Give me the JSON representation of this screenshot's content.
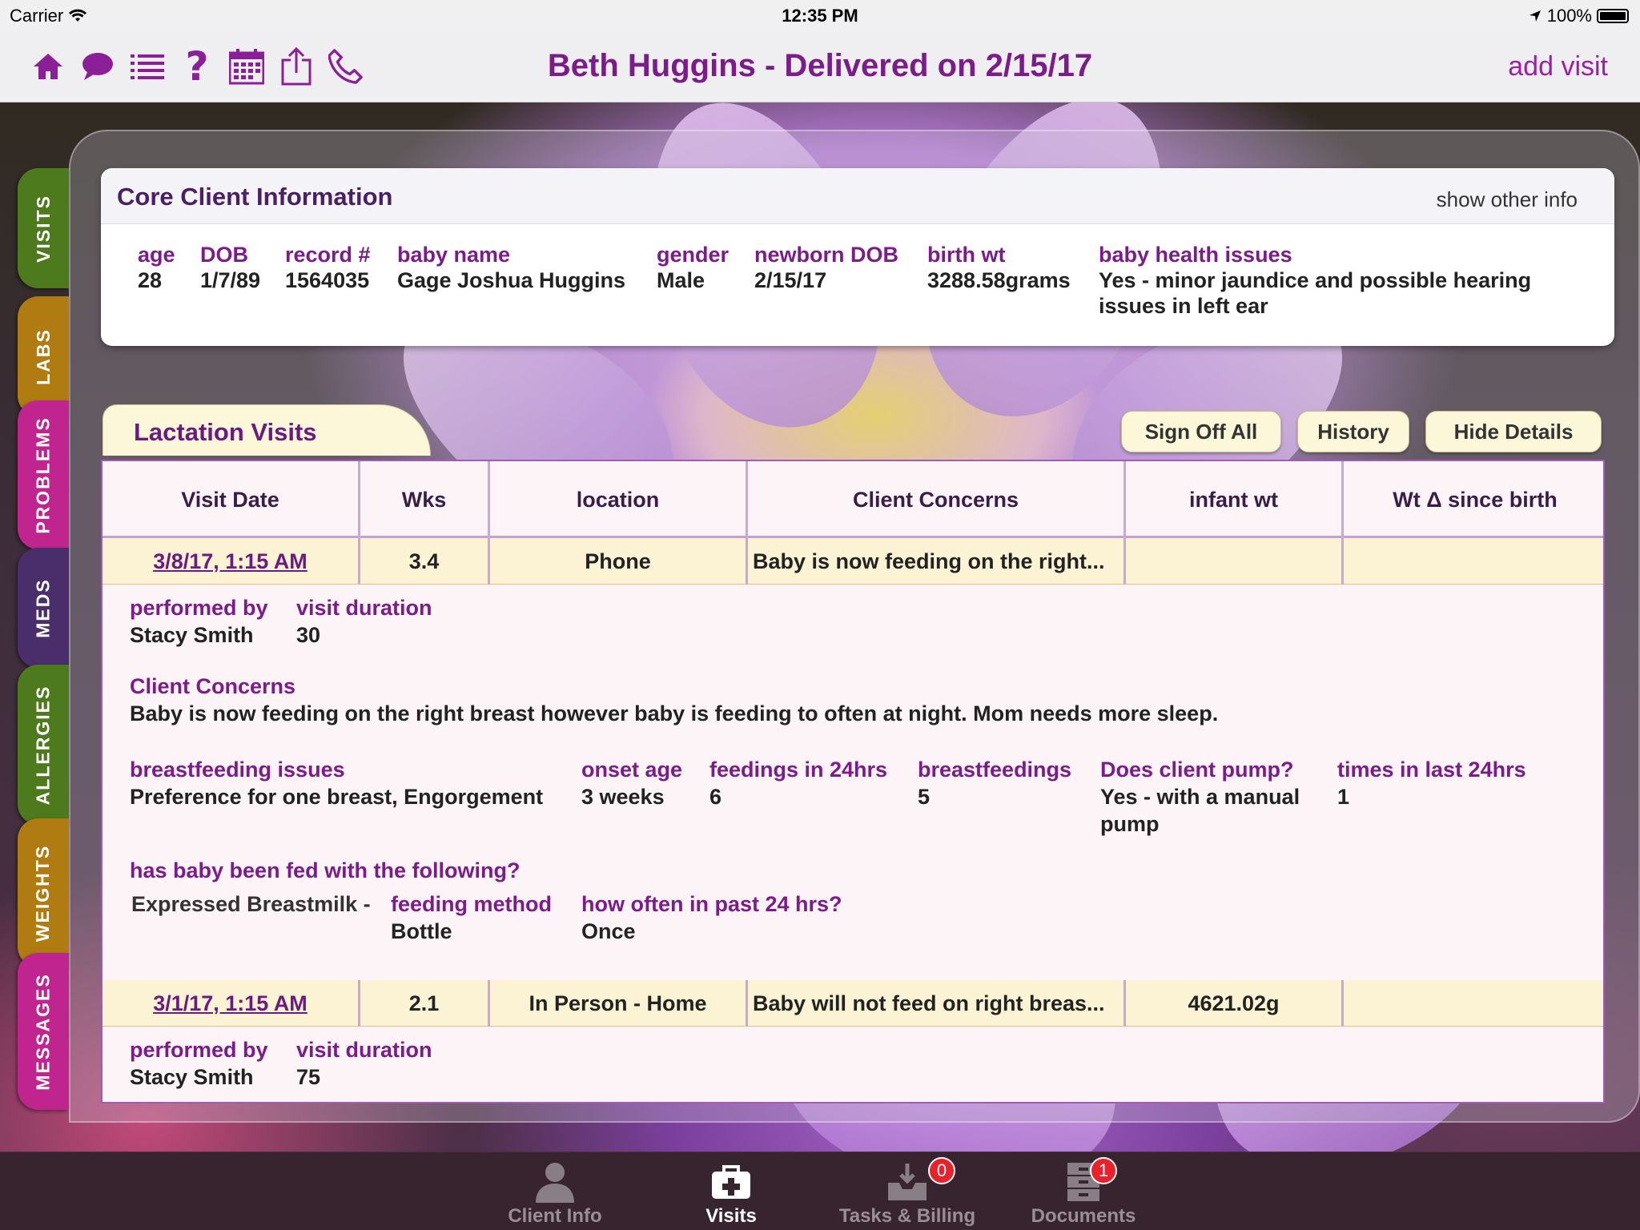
{
  "status_bar": {
    "carrier": "Carrier",
    "time": "12:35 PM",
    "battery": "100%"
  },
  "nav": {
    "title": "Beth Huggins - Delivered on 2/15/17",
    "add_visit": "add visit",
    "icons": [
      "home-icon",
      "chat-icon",
      "list-icon",
      "help-icon",
      "calendar-icon",
      "share-icon",
      "phone-icon"
    ]
  },
  "side_tabs": [
    {
      "label": "VISITS",
      "color": "#4e7a1e"
    },
    {
      "label": "LABS",
      "color": "#b07c12"
    },
    {
      "label": "PROBLEMS",
      "color": "#c0258f"
    },
    {
      "label": "MEDS",
      "color": "#4a2d6b"
    },
    {
      "label": "ALLERGIES",
      "color": "#4e7a1e"
    },
    {
      "label": "WEIGHTS",
      "color": "#b07c12"
    },
    {
      "label": "MESSAGES",
      "color": "#c0258f"
    }
  ],
  "core": {
    "title": "Core Client Information",
    "show_other": "show other info",
    "fields": [
      {
        "label": "age",
        "value": "28"
      },
      {
        "label": "DOB",
        "value": "1/7/89"
      },
      {
        "label": "record #",
        "value": "1564035"
      },
      {
        "label": "baby name",
        "value": "Gage Joshua Huggins"
      },
      {
        "label": "gender",
        "value": "Male"
      },
      {
        "label": "newborn DOB",
        "value": "2/15/17"
      },
      {
        "label": "birth wt",
        "value": "3288.58grams"
      },
      {
        "label": "baby health issues",
        "value": "Yes - minor jaundice and possible hearing issues in left ear"
      }
    ]
  },
  "lactation": {
    "title": "Lactation Visits",
    "buttons": {
      "sign_off": "Sign Off All",
      "history": "History",
      "hide": "Hide Details"
    },
    "columns": [
      "Visit Date",
      "Wks",
      "location",
      "Client Concerns",
      "infant wt",
      "Wt Δ since birth"
    ],
    "visits": [
      {
        "date": "3/8/17, 1:15 AM",
        "wks": "3.4",
        "location": "Phone",
        "concerns": "Baby is now feeding on the right...",
        "infant_wt": "",
        "wt_delta": "",
        "details": {
          "performed_by_label": "performed by",
          "performed_by": "Stacy Smith",
          "duration_label": "visit duration",
          "duration": "30",
          "concerns_label": "Client Concerns",
          "concerns_full": "Baby is now feeding on the right breast however baby is feeding to often at night.  Mom needs more sleep.",
          "bf_issues_label": "breastfeeding issues",
          "bf_issues": "Preference for one breast, Engorgement",
          "onset_label": "onset age",
          "onset": "3 weeks",
          "feedings_label": "feedings in 24hrs",
          "feedings": "6",
          "breastfeedings_label": "breastfeedings",
          "breastfeedings": "5",
          "pump_label": "Does client pump?",
          "pump": "Yes - with a manual pump",
          "times_label": "times in last 24hrs",
          "times": "1",
          "fed_label": "has baby been fed with the following?",
          "fed_item": "Expressed Breastmilk -",
          "method_label": "feeding method",
          "method": "Bottle",
          "often_label": "how often in past 24 hrs?",
          "often": "Once"
        }
      },
      {
        "date": "3/1/17, 1:15 AM",
        "wks": "2.1",
        "location": "In Person - Home",
        "concerns": "Baby will not feed on right breas...",
        "infant_wt": "4621.02g",
        "wt_delta": "",
        "details": {
          "performed_by_label": "performed by",
          "performed_by": "Stacy Smith",
          "duration_label": "visit duration",
          "duration": "75"
        }
      }
    ]
  },
  "tabbar": {
    "items": [
      {
        "label": "Client Info",
        "icon": "person-icon"
      },
      {
        "label": "Visits",
        "icon": "medical-bag-icon"
      },
      {
        "label": "Tasks & Billing",
        "icon": "inbox-download-icon",
        "badge": "0"
      },
      {
        "label": "Documents",
        "icon": "file-cabinet-icon",
        "badge": "1"
      }
    ]
  }
}
